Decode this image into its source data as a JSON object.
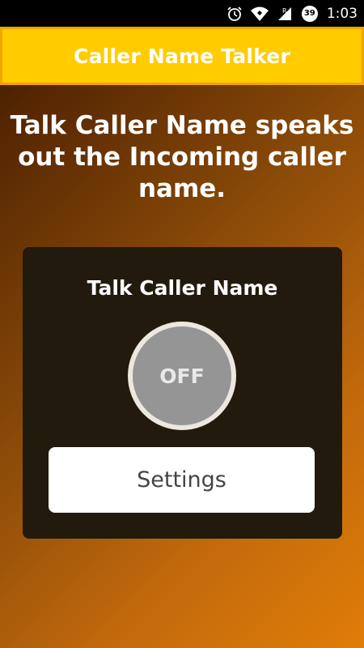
{
  "status_bar": {
    "time": "1:03",
    "battery_level": "39",
    "icons": [
      "alarm-icon",
      "wifi-icon",
      "signal-roaming-icon",
      "battery-icon"
    ]
  },
  "header": {
    "title": "Caller Name Talker"
  },
  "main": {
    "description": "Talk Caller Name speaks out the Incoming caller name.",
    "panel": {
      "title": "Talk Caller Name",
      "toggle_label": "OFF",
      "settings_label": "Settings"
    }
  },
  "colors": {
    "header_background": "#ffcc00",
    "header_border": "#f3a400",
    "panel_background": "#221a0c",
    "toggle_background": "#959595"
  }
}
